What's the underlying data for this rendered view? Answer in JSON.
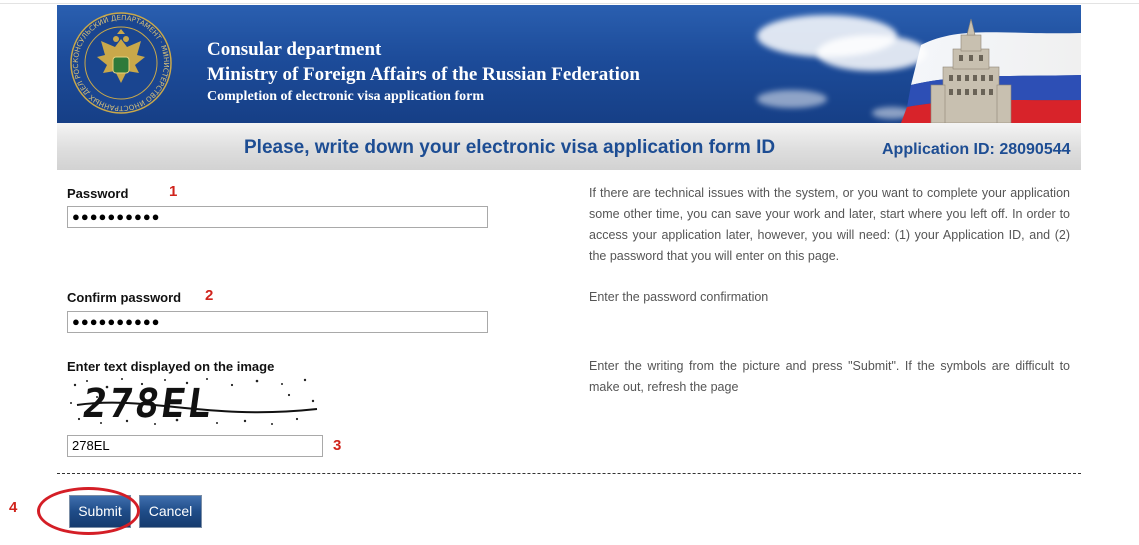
{
  "header": {
    "line1": "Consular department",
    "line2": "Ministry of Foreign Affairs of the Russian Federation",
    "line3": "Completion of electronic visa application form",
    "emblem_text": "КОНСУЛЬСКИЙ ДЕПАРТАМЕНТ · МИНИСТЕРСТВО ИНОСТРАННЫХ ДЕЛ РОССИИ"
  },
  "title_bar": {
    "title": "Please, write down your electronic visa application form ID",
    "application_id": "Application ID: 28090544"
  },
  "form": {
    "password_label": "Password",
    "password_value": "●●●●●●●●●●",
    "confirm_label": "Confirm password",
    "confirm_value": "●●●●●●●●●●",
    "captcha_label": "Enter text displayed on the image",
    "captcha_image_text": "278EL",
    "captcha_value": "278EL"
  },
  "help": {
    "password": "If there are technical issues with the system, or you want to complete your application some other time, you can save your work and later, start where you left off. In order to access your application later, however, you will need: (1) your Application ID, and (2) the password that you will enter on this page.",
    "confirm": "Enter the password confirmation",
    "captcha": "Enter the writing from the picture and press \"Submit\". If the symbols are difficult to make out, refresh the page"
  },
  "markers": {
    "m1": "1",
    "m2": "2",
    "m3": "3",
    "m4": "4"
  },
  "buttons": {
    "submit": "Submit",
    "cancel": "Cancel"
  },
  "colors": {
    "banner_blue": "#1d4c9a",
    "title_blue": "#1d4d93",
    "marker_red": "#d0241c",
    "button_blue": "#1f4c88"
  }
}
